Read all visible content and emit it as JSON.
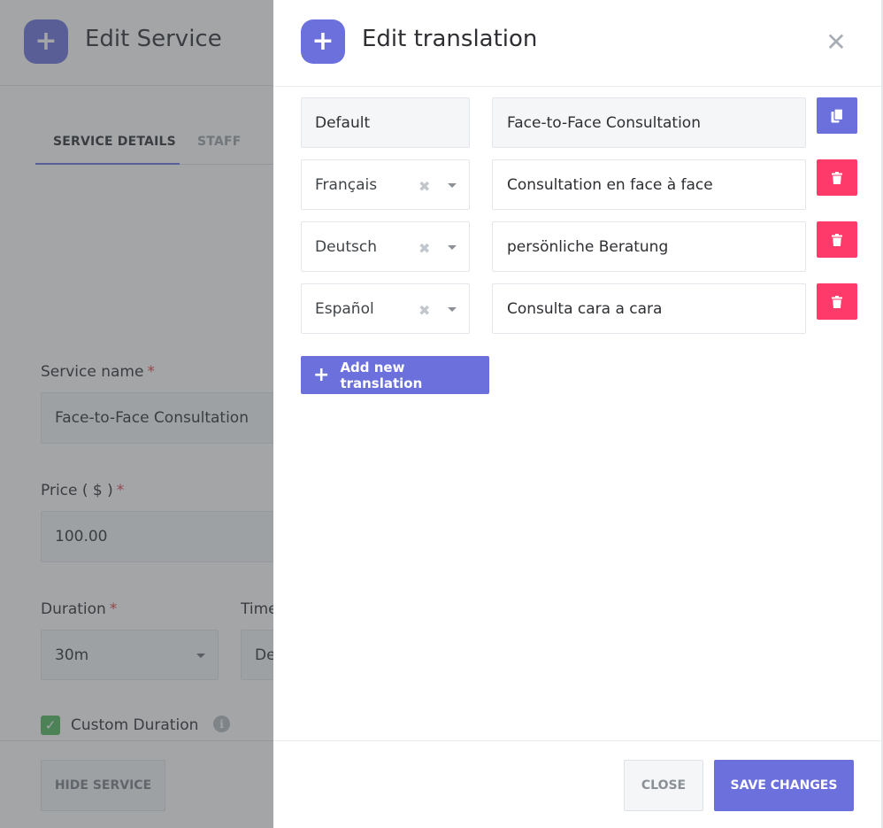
{
  "background": {
    "title": "Edit Service",
    "tabs": [
      {
        "label": "SERVICE DETAILS",
        "active": true
      },
      {
        "label": "STAFF",
        "active": false
      }
    ],
    "service_name": {
      "label": "Service name",
      "value": "Face-to-Face Consultation"
    },
    "price": {
      "label": "Price ( $ )",
      "value": "100.00"
    },
    "duration": {
      "label": "Duration",
      "value": "30m"
    },
    "timeslot": {
      "label": "Time",
      "value": "De"
    },
    "custom_duration": {
      "label": "Custom Duration",
      "checked": true
    },
    "hide_service_label": "HIDE SERVICE",
    "required_mark": "*"
  },
  "panel": {
    "title": "Edit translation",
    "rows": [
      {
        "language": "Default",
        "text": "Face-to-Face Consultation",
        "action": "copy"
      },
      {
        "language": "Français",
        "text": "Consultation en face à face",
        "action": "delete"
      },
      {
        "language": "Deutsch",
        "text": "persönliche Beratung",
        "action": "delete"
      },
      {
        "language": "Español",
        "text": "Consulta cara a cara",
        "action": "delete"
      }
    ],
    "add_label": "Add new translation",
    "close_label": "CLOSE",
    "save_label": "SAVE CHANGES"
  },
  "colors": {
    "accent": "#6c70dc",
    "delete": "#fe3a6a",
    "check": "#53b95f"
  },
  "icons": {
    "header": "plus-icon",
    "close": "close-icon",
    "copy": "copy-icon",
    "delete": "trash-icon",
    "clear": "clear-icon",
    "dropdown": "chevron-down-icon",
    "info": "info-icon"
  }
}
